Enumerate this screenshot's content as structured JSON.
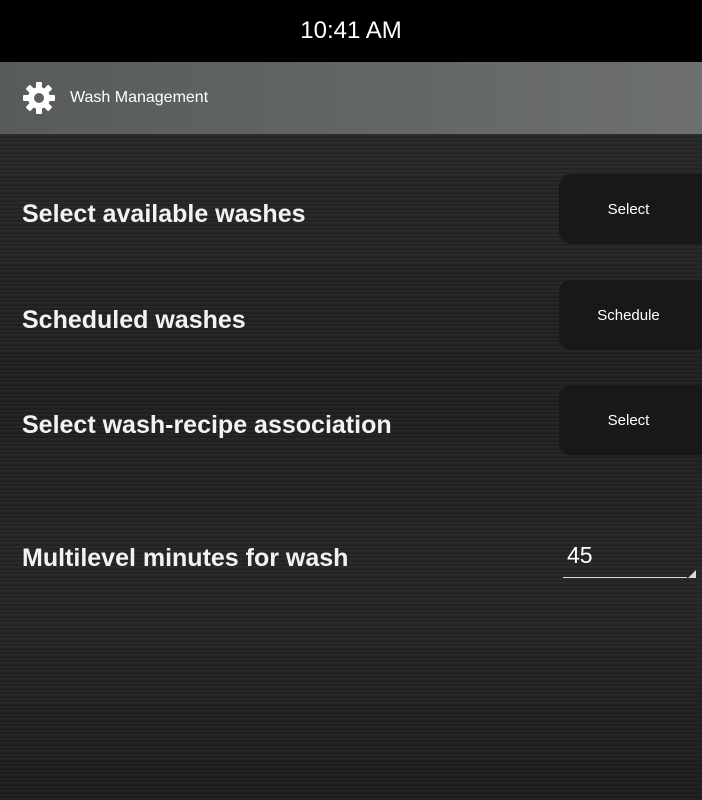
{
  "status_bar": {
    "time": "10:41 AM"
  },
  "app_bar": {
    "icon": "gear-icon",
    "title": "Wash Management"
  },
  "settings": {
    "select_available_washes": {
      "label": "Select available washes",
      "button_label": "Select"
    },
    "scheduled_washes": {
      "label": "Scheduled washes",
      "button_label": "Schedule"
    },
    "wash_recipe_association": {
      "label": "Select wash-recipe association",
      "button_label": "Select"
    },
    "multilevel_minutes": {
      "label": "Multilevel minutes for wash",
      "value": "45"
    }
  },
  "colors": {
    "status_bar_bg": "#000000",
    "app_bar_bg": "#626566",
    "content_bg": "#222222",
    "button_bg": "#181818",
    "text": "#ffffff"
  }
}
